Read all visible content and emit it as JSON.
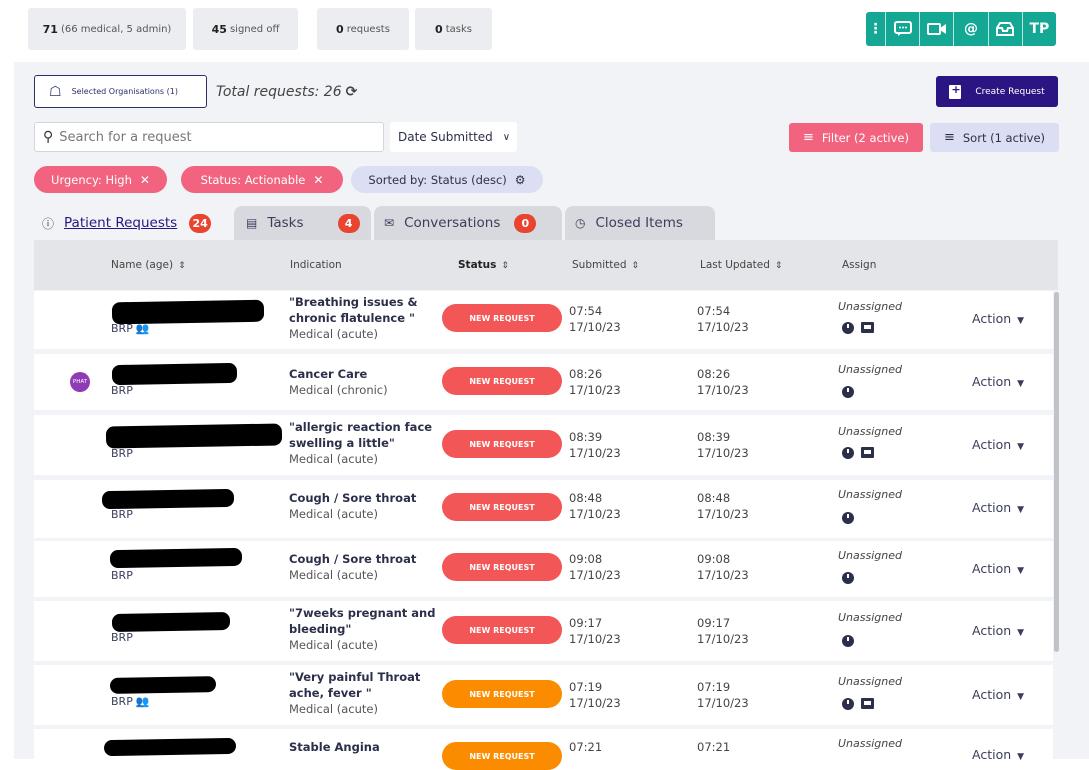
{
  "stats": [
    {
      "value": "71",
      "label": "(66 medical, 5 admin)"
    },
    {
      "value": "45",
      "label": "signed off"
    },
    {
      "value": "0",
      "label": "requests"
    },
    {
      "value": "0",
      "label": "tasks"
    }
  ],
  "comms": {
    "initials": "TP"
  },
  "toolbar": {
    "org_label": "Selected Organisations (1)",
    "total_requests": "Total requests: 26",
    "create_label": "Create Request",
    "search_placeholder": "Search for a request",
    "date_select": "Date Submitted",
    "filter_label": "Filter (2 active)",
    "sort_label": "Sort (1 active)"
  },
  "chips": {
    "urgency": "Urgency: High",
    "status": "Status: Actionable",
    "sorted": "Sorted by: Status (desc)"
  },
  "tabs": [
    {
      "label": "Patient Requests",
      "count": "24"
    },
    {
      "label": "Tasks",
      "count": "4"
    },
    {
      "label": "Conversations",
      "count": "0"
    },
    {
      "label": "Closed Items"
    }
  ],
  "table": {
    "headers": {
      "name": "Name (age)",
      "indication": "Indication",
      "status": "Status",
      "submitted": "Submitted",
      "updated": "Last Updated",
      "assign": "Assign"
    },
    "rows": [
      {
        "org": "BRP",
        "group": true,
        "title": "\"Breathing issues & chronic flatulence \"",
        "sub": "Medical (acute)",
        "status": "NEW REQUEST",
        "st": "07:54",
        "sd": "17/10/23",
        "ut": "07:54",
        "ud": "17/10/23",
        "assign": "Unassigned",
        "chat": true,
        "action": "Action"
      },
      {
        "org": "BRP",
        "avatar": "PHAT",
        "title": "Cancer Care",
        "sub": "Medical (chronic)",
        "status": "NEW REQUEST",
        "st": "08:26",
        "sd": "17/10/23",
        "ut": "08:26",
        "ud": "17/10/23",
        "assign": "Unassigned",
        "action": "Action"
      },
      {
        "org": "BRP",
        "title": "\"allergic reaction face swelling a little\"",
        "sub": "Medical (acute)",
        "status": "NEW REQUEST",
        "st": "08:39",
        "sd": "17/10/23",
        "ut": "08:39",
        "ud": "17/10/23",
        "assign": "Unassigned",
        "chat": true,
        "action": "Action"
      },
      {
        "org": "BRP",
        "title": "Cough / Sore throat",
        "sub": "Medical (acute)",
        "status": "NEW REQUEST",
        "st": "08:48",
        "sd": "17/10/23",
        "ut": "08:48",
        "ud": "17/10/23",
        "assign": "Unassigned",
        "action": "Action"
      },
      {
        "org": "BRP",
        "title": "Cough / Sore throat",
        "sub": "Medical (acute)",
        "status": "NEW REQUEST",
        "st": "09:08",
        "sd": "17/10/23",
        "ut": "09:08",
        "ud": "17/10/23",
        "assign": "Unassigned",
        "action": "Action"
      },
      {
        "org": "BRP",
        "title": "\"7weeks pregnant and bleeding\"",
        "sub": "Medical (acute)",
        "status": "NEW REQUEST",
        "st": "09:17",
        "sd": "17/10/23",
        "ut": "09:17",
        "ud": "17/10/23",
        "assign": "Unassigned",
        "action": "Action"
      },
      {
        "org": "BRP",
        "group": true,
        "title": "\"Very painful Throat ache, fever \"",
        "sub": "Medical (acute)",
        "status": "NEW REQUEST",
        "st": "07:19",
        "sd": "17/10/23",
        "ut": "07:19",
        "ud": "17/10/23",
        "assign": "Unassigned",
        "chat": true,
        "action": "Action"
      },
      {
        "org": "",
        "title": "Stable Angina",
        "sub": "",
        "status": "NEW REQUEST",
        "st": "07:21",
        "sd": "",
        "ut": "07:21",
        "ud": "",
        "assign": "Unassigned",
        "action": "Action"
      }
    ]
  },
  "colors": {
    "accent": "#2b1582",
    "pink": "#f2637f",
    "teal": "#13a794",
    "orange": "#fb8c00",
    "coral": "#f25656"
  }
}
